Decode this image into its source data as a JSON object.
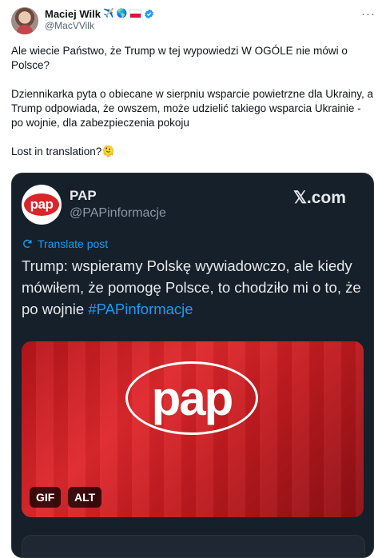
{
  "author": {
    "name": "Maciej Wilk",
    "handle": "@MacVVilk",
    "emoji_plane": "✈️",
    "emoji_globe": "🌎"
  },
  "tweet": {
    "text": "Ale wiecie Państwo, że Trump w tej wypowiedzi W OGÓLE nie mówi o Polsce?\n\nDziennikarka pyta o obiecane w sierpniu wsparcie powietrzne dla Ukrainy, a Trump odpowiada, że owszem, może udzielić takiego wsparcia Ukrainie - po wojnie, dla zabezpieczenia pokoju\n\nLost in translation?🫠"
  },
  "card": {
    "name": "PAP",
    "handle": "@PAPinformacje",
    "source": "𝕏.com",
    "logo_text": "pap",
    "translate_label": "Translate post",
    "text": "Trump: wspieramy Polskę wywiadowczo, ale kiedy mówiłem, że pomogę Polsce, to chodziło mi o to, że po wojnie ",
    "hashtag": "#PAPinformacje",
    "media_logo": "pap",
    "gif_label": "GIF",
    "alt_label": "ALT"
  },
  "colors": {
    "link": "#1d9bf0",
    "card_bg": "#15202b",
    "brand_red": "#d8262b",
    "verified": "#1d9bf0"
  },
  "icons": [
    "verified-badge-icon",
    "more-options-icon",
    "translate-icon",
    "poland-flag-icon"
  ]
}
